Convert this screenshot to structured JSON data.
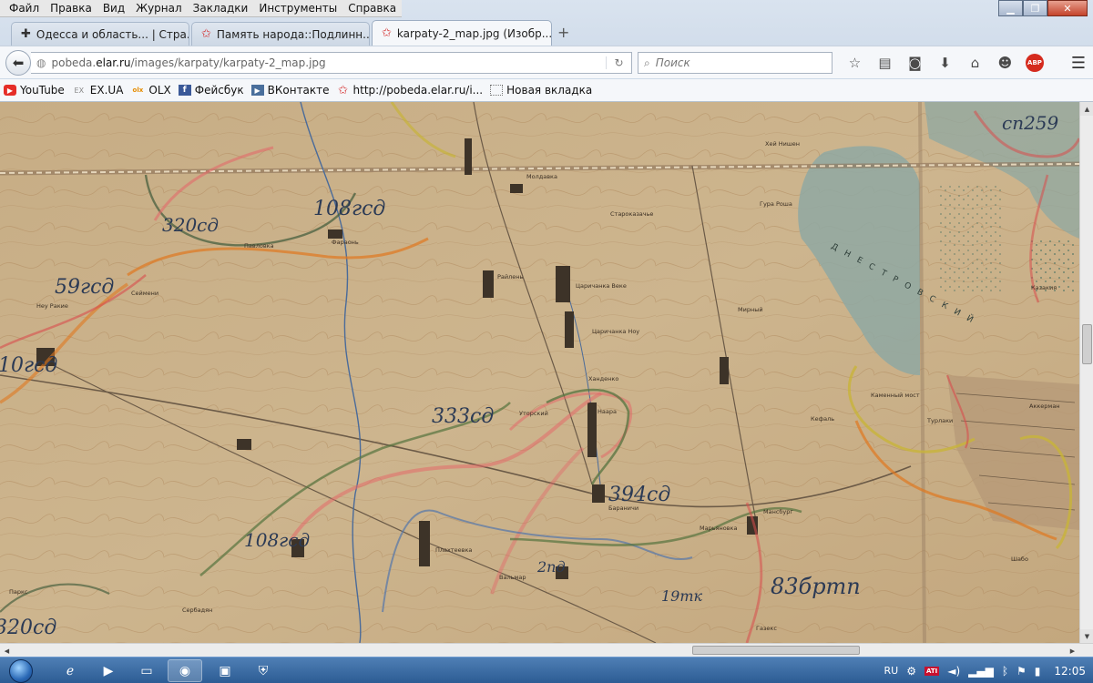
{
  "menu": [
    "Файл",
    "Правка",
    "Вид",
    "Журнал",
    "Закладки",
    "Инструменты",
    "Справка"
  ],
  "window_controls": {
    "minimize": "▁",
    "restore": "❐",
    "close": "✕"
  },
  "tabs": [
    {
      "title": "Одесса и область... | Стра...",
      "icon": "cross-icon",
      "active": false
    },
    {
      "title": "Память народа::Подлинн...",
      "icon": "red-star-icon",
      "active": false
    },
    {
      "title": "karpaty-2_map.jpg (Изобр...",
      "icon": "red-star-icon",
      "active": true
    }
  ],
  "new_tab": "+",
  "address": {
    "prefix": "pobeda.",
    "domain": "elar.ru",
    "path": "/images/karpaty/karpaty-2_map.jpg"
  },
  "search": {
    "placeholder": "Поиск"
  },
  "bookmarks": [
    {
      "label": "YouTube",
      "icon": "youtube-icon"
    },
    {
      "label": "EX.UA",
      "icon": "exua-icon"
    },
    {
      "label": "OLX",
      "icon": "olx-icon"
    },
    {
      "label": "Фейсбук",
      "icon": "facebook-icon"
    },
    {
      "label": "ВКонтакте",
      "icon": "vk-icon"
    },
    {
      "label": "http://pobeda.elar.ru/i...",
      "icon": "red-star-icon"
    },
    {
      "label": "Новая вкладка",
      "icon": "blank-page-icon"
    }
  ],
  "map": {
    "unit_labels": [
      "108гсд",
      "320сд",
      "59гсд",
      "10гсд",
      "333сд",
      "394сд",
      "108гсд",
      "2пд",
      "19тк",
      "83бртп",
      "320сд",
      "сп259"
    ],
    "places": [
      "Молдавка",
      "Фараонь",
      "Староказачье",
      "Гура Роша",
      "Райлень",
      "Царичанка Веке",
      "Царичанка Ноу",
      "Павловка",
      "Плахтеевка",
      "Бараничи",
      "Ханденко",
      "Уторский",
      "Наара",
      "Мансбург",
      "Марьяновка",
      "Вальмар",
      "Мирный",
      "Хей Нишен",
      "Каменный мост",
      "Турлаки",
      "Аккерман",
      "Шабо",
      "Сербадян",
      "Газекс",
      "Казакия",
      "Паркс",
      "Сеймени",
      "Кефаль",
      "Неу Ракие"
    ],
    "lake_label": "ДНЕСТРОВСКИЙ"
  },
  "taskbar": {
    "apps": [
      "ie-icon",
      "media-player-icon",
      "explorer-icon",
      "firefox-icon",
      "save-icon",
      "antivirus-icon"
    ],
    "tray": {
      "lang": "RU",
      "ati": "ATI",
      "time": "12:05"
    }
  }
}
